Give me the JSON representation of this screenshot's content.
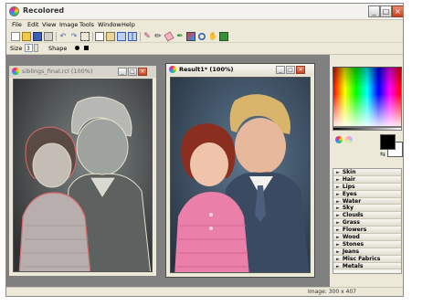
{
  "app": {
    "title": "Recolored"
  },
  "window_controls": {
    "minimize": "_",
    "maximize": "□",
    "close": "×"
  },
  "menu": [
    "File",
    "Edit",
    "View",
    "Image",
    "Tools",
    "Window",
    "Help"
  ],
  "toolbar": {
    "icons": [
      "new-icon",
      "open-icon",
      "save-icon",
      "print-icon",
      "undo-icon",
      "redo-icon",
      "crop-icon",
      "copy-icon",
      "paste-icon",
      "fit-icon",
      "split-icon",
      "brush-icon",
      "pen-icon",
      "eraser-icon",
      "dropper-icon",
      "fill-icon",
      "magnify-icon",
      "hand-icon",
      "export-icon"
    ]
  },
  "options": {
    "size_label": "Size",
    "size_value": "3",
    "shape_label": "Shape"
  },
  "documents": {
    "original": {
      "title": "siblings_final.rcl (100%)"
    },
    "result": {
      "title": "Result1* (100%)"
    }
  },
  "categories": [
    "Skin",
    "Hair",
    "Lips",
    "Eyes",
    "Water",
    "Sky",
    "Clouds",
    "Grass",
    "Flowers",
    "Wood",
    "Stones",
    "Jeans",
    "Misc Fabrics",
    "Metals"
  ],
  "status": {
    "image_size": "Image: 300 x 407"
  },
  "colors": {
    "foreground": "#000000",
    "background": "#ffffff",
    "accent": "#c8421e"
  }
}
